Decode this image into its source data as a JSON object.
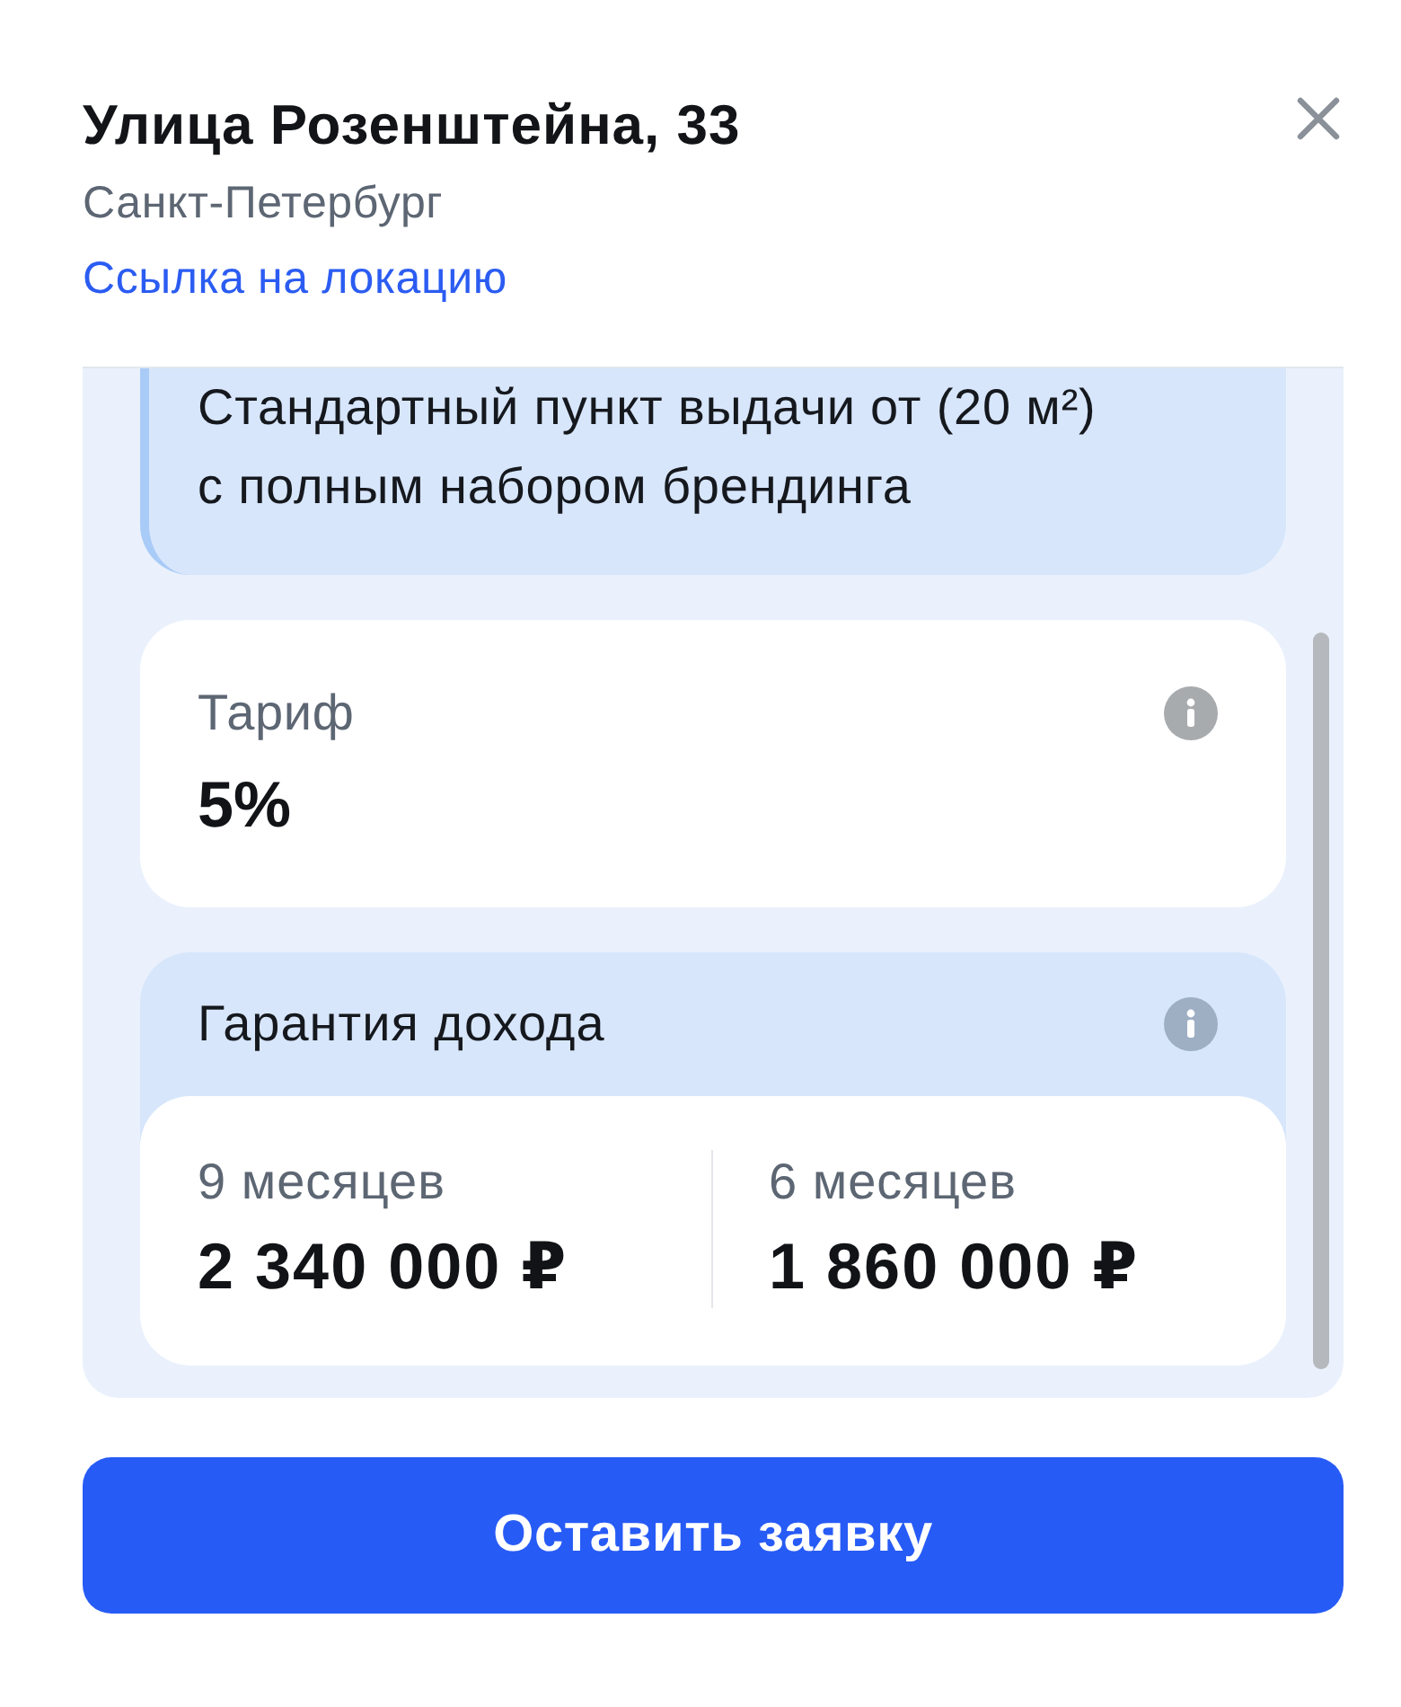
{
  "header": {
    "title": "Улица Розенштейна, 33",
    "city": "Санкт-Петербург",
    "link": "Ссылка на локацию"
  },
  "description": {
    "text": "Стандартный пункт выдачи от (20 м²) с полным набором брендинга"
  },
  "tariff": {
    "label": "Тариф",
    "value": "5%"
  },
  "guarantee": {
    "title": "Гарантия дохода",
    "options": [
      {
        "period": "9 месяцев",
        "amount": "2 340 000 ₽"
      },
      {
        "period": "6 месяцев",
        "amount": "1 860 000 ₽"
      }
    ]
  },
  "button": {
    "label": "Оставить заявку"
  }
}
